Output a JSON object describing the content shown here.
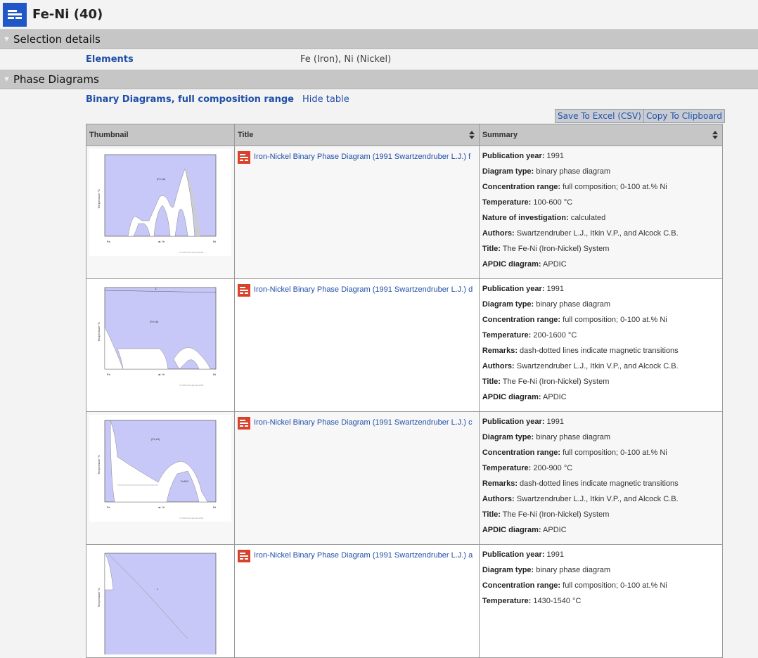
{
  "header": {
    "title": "Fe-Ni (40)"
  },
  "sections": {
    "selection": "Selection details",
    "phase": "Phase Diagrams"
  },
  "details": {
    "label": "Elements",
    "value": "Fe (Iron), Ni (Nickel)"
  },
  "subhead": {
    "label": "Binary Diagrams, full composition range",
    "hide": "Hide table"
  },
  "buttons": {
    "excel": "Save To Excel (CSV)",
    "clipboard": "Copy To Clipboard"
  },
  "table": {
    "columns": [
      "Thumbnail",
      "Title",
      "Summary"
    ],
    "rows": [
      {
        "title": "Iron-Nickel Binary Phase Diagram (1991 Swartzendruber L.J.) f",
        "summary": [
          {
            "k": "Publication year:",
            "v": "1991"
          },
          {
            "k": "Diagram type:",
            "v": "binary phase diagram"
          },
          {
            "k": "Concentration range:",
            "v": "full composition; 0-100 at.% Ni"
          },
          {
            "k": "Temperature:",
            "v": "100-600 °C"
          },
          {
            "k": "Nature of investigation:",
            "v": "calculated"
          },
          {
            "k": "Authors:",
            "v": "Swartzendruber L.J., Itkin V.P., and Alcock C.B."
          },
          {
            "k": "Title:",
            "v": "The Fe-Ni (Iron-Nickel) System"
          },
          {
            "k": "APDIC diagram:",
            "v": "APDIC"
          }
        ]
      },
      {
        "title": "Iron-Nickel Binary Phase Diagram (1991 Swartzendruber L.J.) d",
        "summary": [
          {
            "k": "Publication year:",
            "v": "1991"
          },
          {
            "k": "Diagram type:",
            "v": "binary phase diagram"
          },
          {
            "k": "Concentration range:",
            "v": "full composition; 0-100 at.% Ni"
          },
          {
            "k": "Temperature:",
            "v": "200-1600 °C"
          },
          {
            "k": "Remarks:",
            "v": "dash-dotted lines indicate magnetic transitions"
          },
          {
            "k": "Authors:",
            "v": "Swartzendruber L.J., Itkin V.P., and Alcock C.B."
          },
          {
            "k": "Title:",
            "v": "The Fe-Ni (Iron-Nickel) System"
          },
          {
            "k": "APDIC diagram:",
            "v": "APDIC"
          }
        ]
      },
      {
        "title": "Iron-Nickel Binary Phase Diagram (1991 Swartzendruber L.J.) c",
        "summary": [
          {
            "k": "Publication year:",
            "v": "1991"
          },
          {
            "k": "Diagram type:",
            "v": "binary phase diagram"
          },
          {
            "k": "Concentration range:",
            "v": "full composition; 0-100 at.% Ni"
          },
          {
            "k": "Temperature:",
            "v": "200-900 °C"
          },
          {
            "k": "Remarks:",
            "v": "dash-dotted lines indicate magnetic transitions"
          },
          {
            "k": "Authors:",
            "v": "Swartzendruber L.J., Itkin V.P., and Alcock C.B."
          },
          {
            "k": "Title:",
            "v": "The Fe-Ni (Iron-Nickel) System"
          },
          {
            "k": "APDIC diagram:",
            "v": "APDIC"
          }
        ]
      },
      {
        "title": "Iron-Nickel Binary Phase Diagram (1991 Swartzendruber L.J.) a",
        "summary": [
          {
            "k": "Publication year:",
            "v": "1991"
          },
          {
            "k": "Diagram type:",
            "v": "binary phase diagram"
          },
          {
            "k": "Concentration range:",
            "v": "full composition; 0-100 at.% Ni"
          },
          {
            "k": "Temperature:",
            "v": "1430-1540 °C"
          }
        ]
      }
    ]
  },
  "colors": {
    "link": "#1f4fa8",
    "brand": "#1f56c8",
    "pdf": "#d9412a",
    "section": "#c6c6c6",
    "diagram_fill": "#c8c8f8"
  },
  "icons": {
    "logo": "document-list-icon",
    "pdf": "pdf-document-icon",
    "sort": "sort-icon",
    "collapse": "triangle-down-icon"
  }
}
